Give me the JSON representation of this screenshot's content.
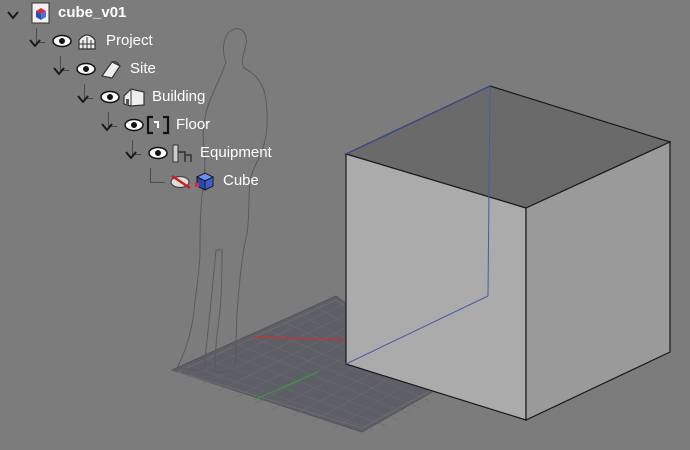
{
  "tree": {
    "root": {
      "label": "cube_v01"
    },
    "items": [
      {
        "label": "Project",
        "icon": "project-icon"
      },
      {
        "label": "Site",
        "icon": "site-icon"
      },
      {
        "label": "Building",
        "icon": "building-icon"
      },
      {
        "label": "Floor",
        "icon": "floor-icon"
      },
      {
        "label": "Equipment",
        "icon": "equipment-icon"
      },
      {
        "label": "Cube",
        "icon": "cube-icon",
        "hidden": true
      }
    ]
  },
  "colors": {
    "background": "#7c7c7c",
    "grid_plane": "#5e5e66",
    "cube_front": "#ababab",
    "cube_top": "#6a6a6a",
    "cube_side": "#9a9a9a",
    "x_axis": "#c83232",
    "y_axis": "#3a9a3a",
    "hidden_edge": "#4a5aa8"
  }
}
